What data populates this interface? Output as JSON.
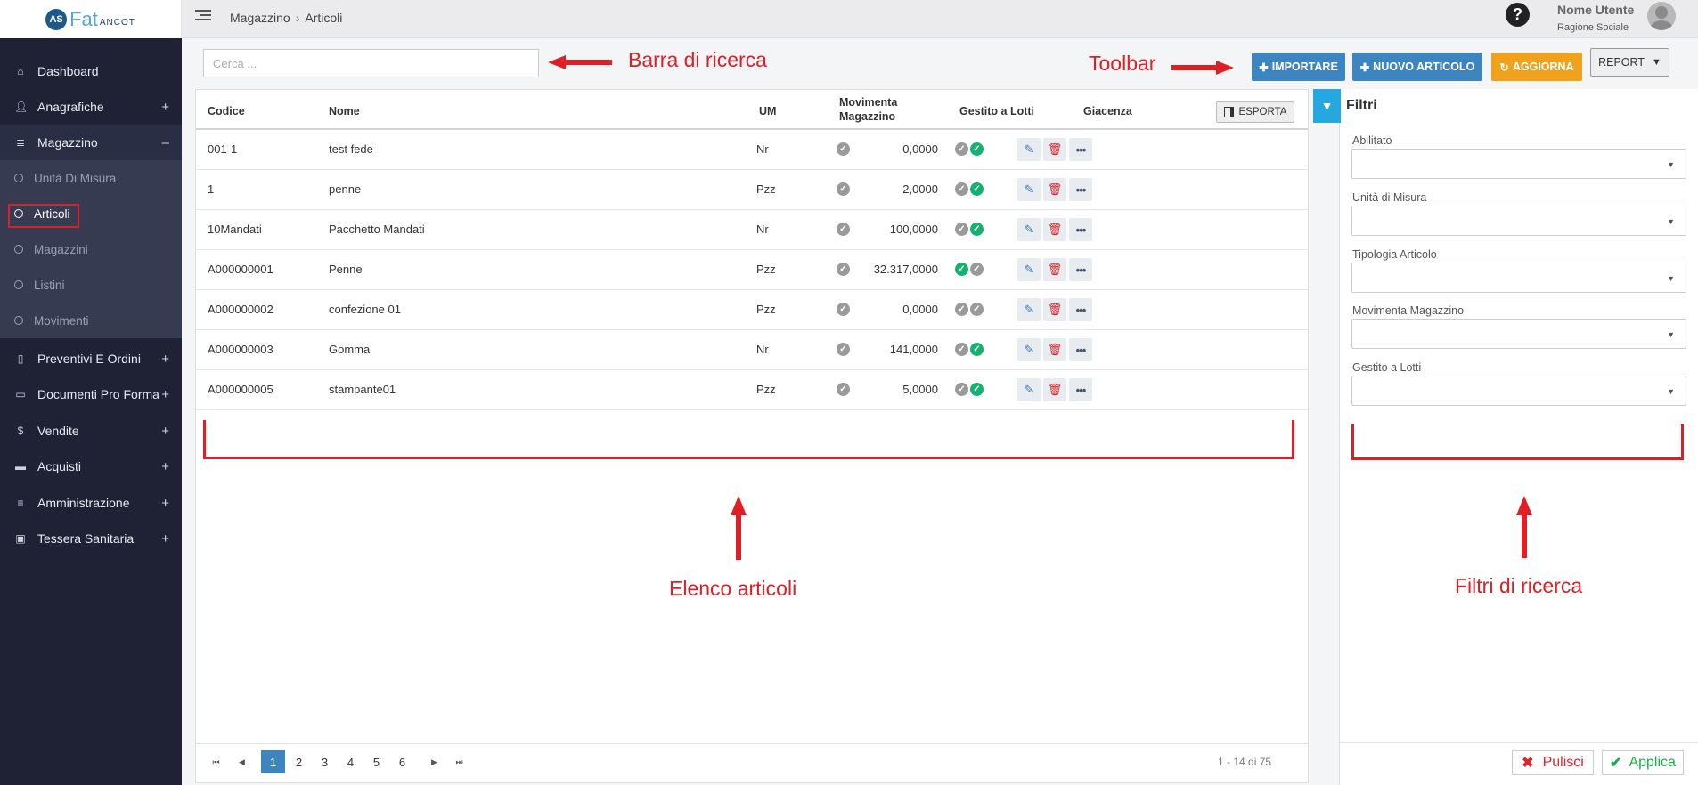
{
  "app": {
    "logo_mark": "AS",
    "logo_main": "Fat",
    "logo_sub": "ANCOT"
  },
  "topbar": {
    "breadcrumb": [
      "Magazzino",
      "Articoli"
    ],
    "help": "?",
    "user_name": "Nome Utente",
    "user_org": "Ragione Sociale"
  },
  "sidebar": {
    "items": [
      {
        "label": "Dashboard",
        "icon": "home-icon",
        "expand": ""
      },
      {
        "label": "Anagrafiche",
        "icon": "user-icon",
        "expand": "+"
      },
      {
        "label": "Magazzino",
        "icon": "list-icon",
        "expand": "–"
      },
      {
        "label": "Preventivi E Ordini",
        "icon": "clipboard-icon",
        "expand": "+"
      },
      {
        "label": "Documenti Pro Forma",
        "icon": "document-icon",
        "expand": "+"
      },
      {
        "label": "Vendite",
        "icon": "dollar-icon",
        "expand": "+"
      },
      {
        "label": "Acquisti",
        "icon": "card-icon",
        "expand": "+"
      },
      {
        "label": "Amministrazione",
        "icon": "database-icon",
        "expand": "+"
      },
      {
        "label": "Tessera Sanitaria",
        "icon": "id-card-icon",
        "expand": "+"
      }
    ],
    "sub_items": [
      "Unità Di Misura",
      "Articoli",
      "Magazzini",
      "Listini",
      "Movimenti"
    ]
  },
  "search": {
    "placeholder": "Cerca ..."
  },
  "toolbar": {
    "import": "IMPORTARE",
    "new": "NUOVO ARTICOLO",
    "refresh": "AGGIORNA",
    "report": "REPORT"
  },
  "annotations": {
    "search_bar": "Barra di ricerca",
    "toolbar": "Toolbar",
    "list": "Elenco articoli",
    "filters": "Filtri di ricerca"
  },
  "table": {
    "headers": {
      "code": "Codice",
      "name": "Nome",
      "um": "UM",
      "mov1": "Movimenta",
      "mov2": "Magazzino",
      "lots": "Gestito a Lotti",
      "stock": "Giacenza",
      "export": "ESPORTA"
    },
    "rows": [
      {
        "code": "001-1",
        "name": "test fede",
        "um": "Nr",
        "mov": false,
        "lots": false,
        "stock": "0,0000",
        "enabled": true
      },
      {
        "code": "1",
        "name": "penne",
        "um": "Pzz",
        "mov": false,
        "lots": false,
        "stock": "2,0000",
        "enabled": true
      },
      {
        "code": "10Mandati",
        "name": "Pacchetto Mandati",
        "um": "Nr",
        "mov": false,
        "lots": false,
        "stock": "100,0000",
        "enabled": true
      },
      {
        "code": "A000000001",
        "name": "Penne",
        "um": "Pzz",
        "mov": false,
        "lots": true,
        "stock": "32.317,0000",
        "enabled": false
      },
      {
        "code": "A000000002",
        "name": "confezione 01",
        "um": "Pzz",
        "mov": false,
        "lots": false,
        "stock": "0,0000",
        "enabled": false
      },
      {
        "code": "A000000003",
        "name": "Gomma",
        "um": "Nr",
        "mov": false,
        "lots": false,
        "stock": "141,0000",
        "enabled": true
      },
      {
        "code": "A000000005",
        "name": "stampante01",
        "um": "Pzz",
        "mov": false,
        "lots": false,
        "stock": "5,0000",
        "enabled": true
      }
    ]
  },
  "pager": {
    "pages": [
      "1",
      "2",
      "3",
      "4",
      "5",
      "6"
    ],
    "current": "1",
    "info": "1 - 14 di 75"
  },
  "filters": {
    "title": "Filtri",
    "fields": [
      "Abilitato",
      "Unità di Misura",
      "Tipologia Articolo",
      "Movimenta Magazzino",
      "Gestito a Lotti"
    ],
    "clear": "Pulisci",
    "apply": "Applica"
  },
  "colors": {
    "sidebar_bg": "#1f2235",
    "primary": "#3d85c1",
    "warning": "#f0a21d",
    "success": "#12b36e",
    "danger": "#d9252b",
    "annotation": "#e01e26"
  }
}
